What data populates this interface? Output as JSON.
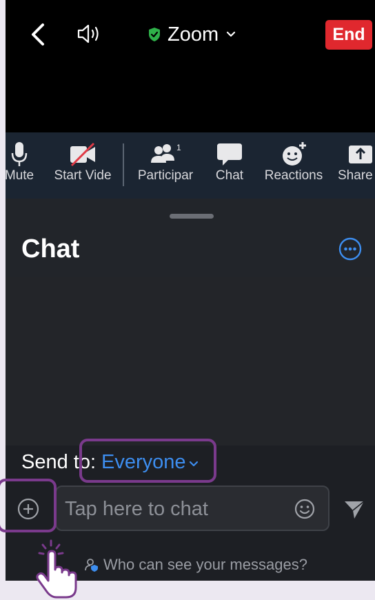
{
  "topbar": {
    "title": "Zoom",
    "end_label": "End",
    "icons": [
      "back-arrow-icon",
      "speaker-icon",
      "shield-check-icon",
      "chevron-down-icon"
    ]
  },
  "toolbar": {
    "items": [
      {
        "label": "Mute",
        "icon": "microphone-icon"
      },
      {
        "label": "Start Vide",
        "icon": "video-off-icon"
      },
      {
        "label": "Participar",
        "icon": "participants-icon",
        "badge": "1"
      },
      {
        "label": "Chat",
        "icon": "chat-bubble-icon"
      },
      {
        "label": "Reactions",
        "icon": "emoji-plus-icon"
      },
      {
        "label": "Share",
        "icon": "share-arrow-icon"
      }
    ]
  },
  "chat": {
    "title": "Chat",
    "send_to_label": "Send to:",
    "send_to_value": "Everyone",
    "input_placeholder": "Tap here to chat",
    "who_can_see": "Who can see your messages?"
  },
  "colors": {
    "accent_blue": "#3d8ef0",
    "end_red": "#e0282e",
    "highlight_purple": "#7a3a8c"
  }
}
